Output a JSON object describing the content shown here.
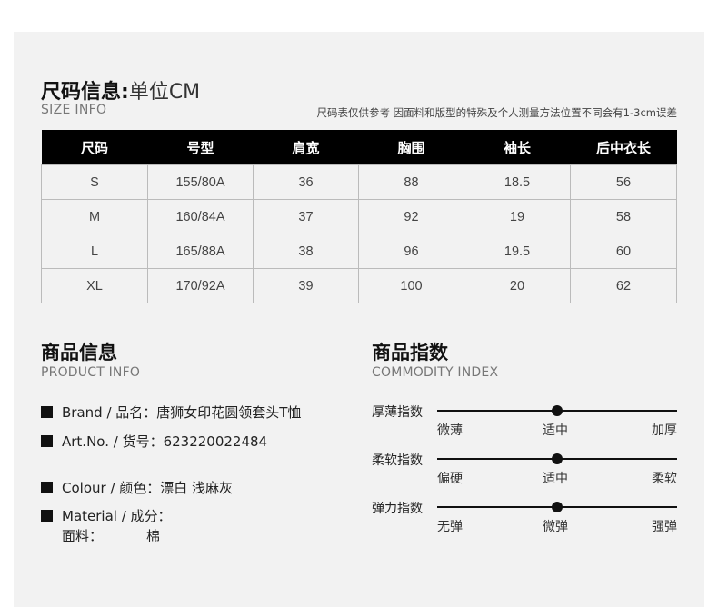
{
  "size_info": {
    "title": "尺码信息:",
    "unit": "单位CM",
    "subtitle": "SIZE INFO",
    "note": "尺码表仅供参考 因面料和版型的特殊及个人测量方法位置不同会有1-3cm误差",
    "headers": [
      "尺码",
      "号型",
      "肩宽",
      "胸围",
      "袖长",
      "后中衣长"
    ],
    "rows": [
      [
        "S",
        "155/80A",
        "36",
        "88",
        "18.5",
        "56"
      ],
      [
        "M",
        "160/84A",
        "37",
        "92",
        "19",
        "58"
      ],
      [
        "L",
        "165/88A",
        "38",
        "96",
        "19.5",
        "60"
      ],
      [
        "XL",
        "170/92A",
        "39",
        "100",
        "20",
        "62"
      ]
    ]
  },
  "product_info": {
    "title": "商品信息",
    "subtitle": "PRODUCT INFO",
    "brand": "Brand / 品名：唐狮女印花圆领套头T恤",
    "art_label": "Art.No. / 货号：",
    "art_value": "623220022484",
    "colour": "Colour / 颜色：漂白 浅麻灰",
    "material_label": "Material / 成分：",
    "fabric_label": "面料：",
    "fabric_value": "棉"
  },
  "commodity_index": {
    "title": "商品指数",
    "subtitle": "COMMODITY INDEX",
    "indices": [
      {
        "label": "厚薄指数",
        "options": [
          "微薄",
          "适中",
          "加厚"
        ],
        "selected_index": 1
      },
      {
        "label": "柔软指数",
        "options": [
          "偏硬",
          "适中",
          "柔软"
        ],
        "selected_index": 1
      },
      {
        "label": "弹力指数",
        "options": [
          "无弹",
          "微弹",
          "强弹"
        ],
        "selected_index": 1
      }
    ]
  },
  "colors": {
    "accent": "#000000",
    "panel": "#f2f2f2"
  }
}
